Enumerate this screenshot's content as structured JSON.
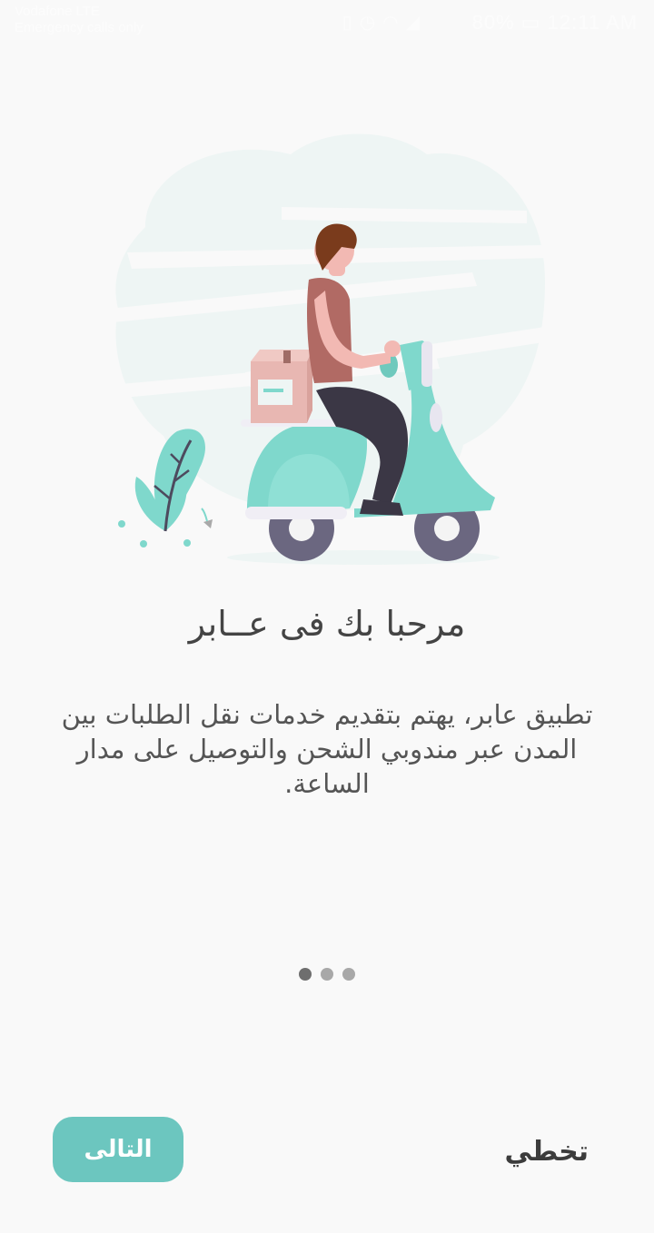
{
  "status_bar": {
    "carrier_line1": "Vodafone LTE",
    "carrier_line2": "Emergency calls only",
    "battery": "80%",
    "time": "12:11 AM",
    "icons": [
      "image-icon",
      "usb-icon",
      "vibrate-icon",
      "alarm-icon",
      "wifi-icon",
      "signal-icon"
    ]
  },
  "illustration": {
    "name": "delivery-scooter-illustration",
    "colors": {
      "background_blob": "#eef5f4",
      "scooter": "#7fd8cc",
      "wheel": "#6b6780",
      "shirt": "#b16a64",
      "pants": "#3b3745",
      "hair": "#7a3b1c",
      "skin": "#f2b9b3",
      "box": "#e8b7b2"
    }
  },
  "onboarding": {
    "title": "مرحبا بك فى عــابر",
    "description": "تطبيق عابر، يهتم بتقديم خدمات نقل الطلبات بين المدن عبر مندوبي الشحن والتوصيل على مدار الساعة.",
    "page_indicator": {
      "total": 3,
      "active_index": 0
    }
  },
  "actions": {
    "next_label": "التالى",
    "skip_label": "تخطي"
  },
  "theme": {
    "accent": "#6cc6bf",
    "background": "#f9f9f9",
    "title_color": "#444444",
    "text_color": "#555555"
  }
}
